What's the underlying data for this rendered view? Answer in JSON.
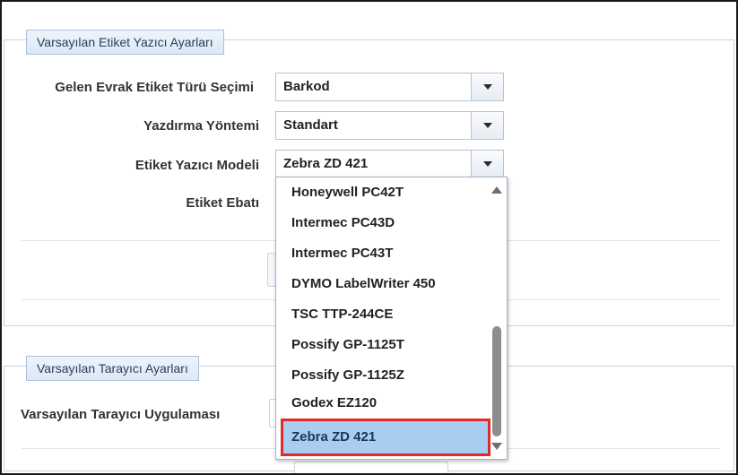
{
  "printer_settings": {
    "legend": "Varsayılan Etiket Yazıcı Ayarları",
    "fields": [
      {
        "label": "Gelen Evrak Etiket Türü Seçimi",
        "value": "Barkod"
      },
      {
        "label": "Yazdırma Yöntemi",
        "value": "Standart"
      },
      {
        "label": "Etiket Yazıcı Modeli",
        "value": "Zebra ZD 421"
      },
      {
        "label": "Etiket Ebatı",
        "value": ""
      }
    ]
  },
  "scanner_settings": {
    "legend": "Varsayılan Tarayıcı Ayarları",
    "fields": [
      {
        "label": "Varsayılan Tarayıcı Uygulaması",
        "value": ""
      }
    ]
  },
  "printer_model_dropdown": {
    "options": [
      "Honeywell PC42T",
      "Intermec PC43D",
      "Intermec PC43T",
      "DYMO LabelWriter 450",
      "TSC TTP-244CE",
      "Possify GP-1125T",
      "Possify GP-1125Z",
      "Godex EZ120",
      "Zebra ZD 421"
    ],
    "selected": "Zebra ZD 421"
  },
  "colors": {
    "selection_highlight": "#a8cdf0",
    "selection_outline": "#e02a2a",
    "panel_border": "#c5d3e3"
  }
}
